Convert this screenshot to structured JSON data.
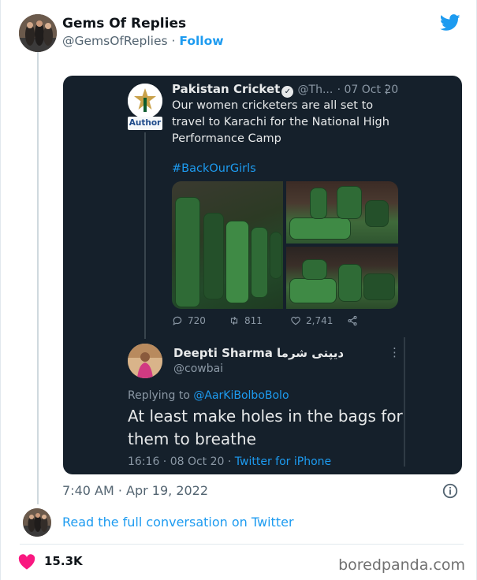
{
  "author": {
    "name": "Gems Of Replies",
    "handle": "@GemsOfReplies",
    "separator": "·",
    "follow_label": "Follow"
  },
  "quoted": {
    "account_name": "Pakistan Cricket",
    "handle_truncated": "@Th...",
    "date": "· 07 Oct 20",
    "more": "⋮",
    "author_badge": "Author",
    "text": "Our women cricketers are all set to travel to Karachi for the National High Performance Camp",
    "hashtag": "#BackOurGirls",
    "replies": "720",
    "retweets": "811",
    "likes": "2,741"
  },
  "reply": {
    "name": "Deepti Sharma دیپتی شرما",
    "handle": "@cowbai",
    "more": "⋮",
    "replying_prefix": "Replying to",
    "replying_to": "@AarKiBolboBolo",
    "text": "At least make holes in the bags for them to breathe",
    "time": "16:16 · 08 Oct 20 ·",
    "source": "Twitter for iPhone"
  },
  "footer": {
    "timestamp": "7:40 AM · Apr 19, 2022",
    "read_link": "Read the full conversation on Twitter",
    "like_count": "15.3K",
    "watermark": "boredpanda.com"
  },
  "colors": {
    "accent": "#1d9bf0",
    "dark_bg": "#15202b",
    "heart": "#f91880"
  }
}
